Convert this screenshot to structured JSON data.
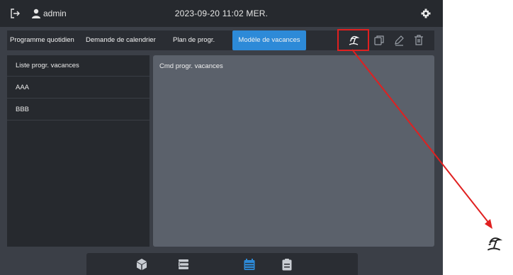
{
  "header": {
    "username": "admin",
    "datetime": "2023-09-20 11:02 MER.",
    "icons": [
      "exit-icon",
      "user-icon",
      "settings-icon"
    ]
  },
  "tabs": [
    {
      "label": "Programme quotidien"
    },
    {
      "label": "Demande de calendrier"
    },
    {
      "label": "Plan de progr."
    },
    {
      "label": "Modèle de vacances",
      "active": true
    }
  ],
  "toolbar": {
    "icons": [
      "vacation-beach-icon",
      "copy-icon",
      "edit-icon",
      "delete-icon"
    ],
    "highlighted": "vacation-beach-icon"
  },
  "left_panel": {
    "header": "Liste progr. vacances",
    "items": [
      "AAA",
      "BBB"
    ]
  },
  "right_panel": {
    "header": "Cmd progr. vacances"
  },
  "bottom_nav": {
    "items": [
      "cube-icon",
      "list-icon",
      "calendar-icon",
      "clipboard-icon"
    ],
    "active": "calendar-icon"
  },
  "colors": {
    "accent": "#2d8ad8",
    "highlight": "#e02020",
    "background": "#3b3f47",
    "panel": "#26292e",
    "content": "#5b616b"
  }
}
